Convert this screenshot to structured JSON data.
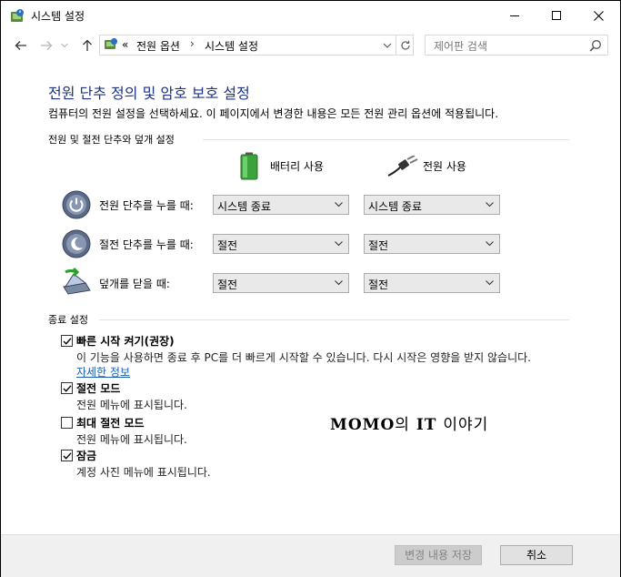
{
  "window": {
    "title": "시스템 설정",
    "icon": "power-options-icon",
    "buttons": [
      "minimize",
      "maximize",
      "close"
    ]
  },
  "address": {
    "overflow": "«",
    "breadcrumbs": [
      "전원 옵션",
      "시스템 설정"
    ],
    "search_placeholder": "제어판 검색"
  },
  "page": {
    "heading": "전원 단추 정의 및 암호 보호 설정",
    "description": "컴퓨터의 전원 설정을 선택하세요. 이 페이지에서 변경한 내용은 모든 전원 관리 옵션에 적용됩니다."
  },
  "buttons_section": {
    "title": "전원 및 절전 단추와 덮개 설정",
    "columns": [
      {
        "label": "배터리 사용",
        "icon": "battery-icon"
      },
      {
        "label": "전원 사용",
        "icon": "power-plug-icon"
      }
    ],
    "rows": [
      {
        "label": "전원 단추를 누를 때:",
        "icon": "power-button-icon",
        "battery": "시스템 종료",
        "plugged": "시스템 종료"
      },
      {
        "label": "절전 단추를 누를 때:",
        "icon": "sleep-button-icon",
        "battery": "절전",
        "plugged": "절전"
      },
      {
        "label": "덮개를 닫을 때:",
        "icon": "laptop-lid-icon",
        "battery": "절전",
        "plugged": "절전"
      }
    ]
  },
  "shutdown_section": {
    "title": "종료 설정",
    "items": [
      {
        "title": "빠른 시작 켜기(권장)",
        "desc": "이 기능을 사용하면 종료 후 PC를 더 빠르게 시작할 수 있습니다. 다시 시작은 영향을 받지 않습니다.",
        "link": "자세한 정보",
        "checked": true
      },
      {
        "title": "절전 모드",
        "desc": "전원 메뉴에 표시됩니다.",
        "checked": true
      },
      {
        "title": "최대 절전 모드",
        "desc": "전원 메뉴에 표시됩니다.",
        "checked": false
      },
      {
        "title": "잠금",
        "desc": "계정 사진 메뉴에 표시됩니다.",
        "checked": true
      }
    ]
  },
  "watermark": {
    "latin": "MOMO",
    "particle": "의",
    "latin2": "IT",
    "suffix": "이야기"
  },
  "footer": {
    "save": "변경 내용 저장",
    "cancel": "취소"
  }
}
